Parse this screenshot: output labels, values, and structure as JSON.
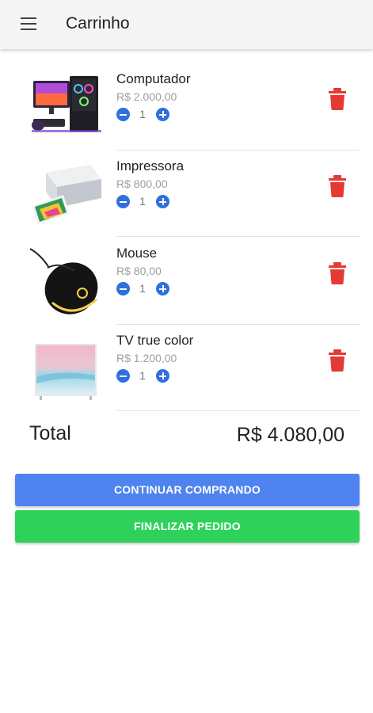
{
  "appbar": {
    "title": "Carrinho",
    "menu_icon": "menu-icon"
  },
  "items": [
    {
      "name": "Computador",
      "price": "R$ 2.000,00",
      "quantity": "1"
    },
    {
      "name": "Impressora",
      "price": "R$ 800,00",
      "quantity": "1"
    },
    {
      "name": "Mouse",
      "price": "R$ 80,00",
      "quantity": "1"
    },
    {
      "name": "TV true color",
      "price": "R$ 1.200,00",
      "quantity": "1"
    }
  ],
  "summary": {
    "total_label": "Total",
    "total_value": "R$ 4.080,00"
  },
  "buttons": {
    "continue_label": "CONTINUAR COMPRANDO",
    "finish_label": "FINALIZAR PEDIDO"
  },
  "colors": {
    "quantity_button": "#2f6fe0",
    "delete_icon": "#e53935",
    "continue_button": "#4f83f0",
    "finish_button": "#2ed25b"
  }
}
